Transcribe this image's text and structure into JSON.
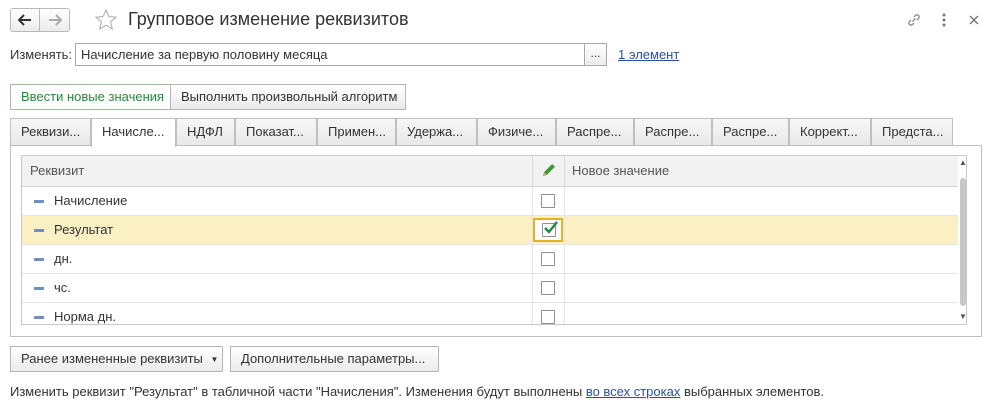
{
  "window": {
    "title": "Групповое изменение реквизитов"
  },
  "change_row": {
    "label": "Изменять:",
    "value": "Начисление за первую половину месяца",
    "choose_button": "...",
    "elements_link": "1 элемент"
  },
  "mode_buttons": [
    {
      "label": "Ввести новые значения",
      "active": true
    },
    {
      "label": "Выполнить произвольный алгоритм",
      "active": false
    }
  ],
  "tabs": [
    {
      "label": "Реквизи..."
    },
    {
      "label": "Начисле..."
    },
    {
      "label": "НДФЛ"
    },
    {
      "label": "Показат..."
    },
    {
      "label": "Примен..."
    },
    {
      "label": "Удержа..."
    },
    {
      "label": "Физиче..."
    },
    {
      "label": "Распре..."
    },
    {
      "label": "Распре..."
    },
    {
      "label": "Распре..."
    },
    {
      "label": "Коррект..."
    },
    {
      "label": "Предста..."
    }
  ],
  "active_tab_index": 1,
  "grid": {
    "columns": {
      "attribute": "Реквизит",
      "change": "",
      "new_value": "Новое значение"
    },
    "rows": [
      {
        "name": "Начисление",
        "checked": false,
        "new_value": ""
      },
      {
        "name": "Результат",
        "checked": true,
        "new_value": ""
      },
      {
        "name": "дн.",
        "checked": false,
        "new_value": ""
      },
      {
        "name": "чс.",
        "checked": false,
        "new_value": ""
      },
      {
        "name": "Норма дн.",
        "checked": false,
        "new_value": ""
      }
    ],
    "selected_row_index": 1
  },
  "bottom_buttons": {
    "previous": "Ранее измененные реквизиты",
    "additional": "Дополнительные параметры..."
  },
  "footer": {
    "text_before": "Изменить реквизит \"Результат\" в табличной части \"Начисления\". Изменения будут выполнены ",
    "link": "во всех строках",
    "text_after": " выбранных элементов."
  },
  "colors": {
    "selected_row": "#fbefc4",
    "active_mode_text": "#1e8c3a",
    "link": "#2a4fa0",
    "check_green": "#1f8a3a"
  }
}
